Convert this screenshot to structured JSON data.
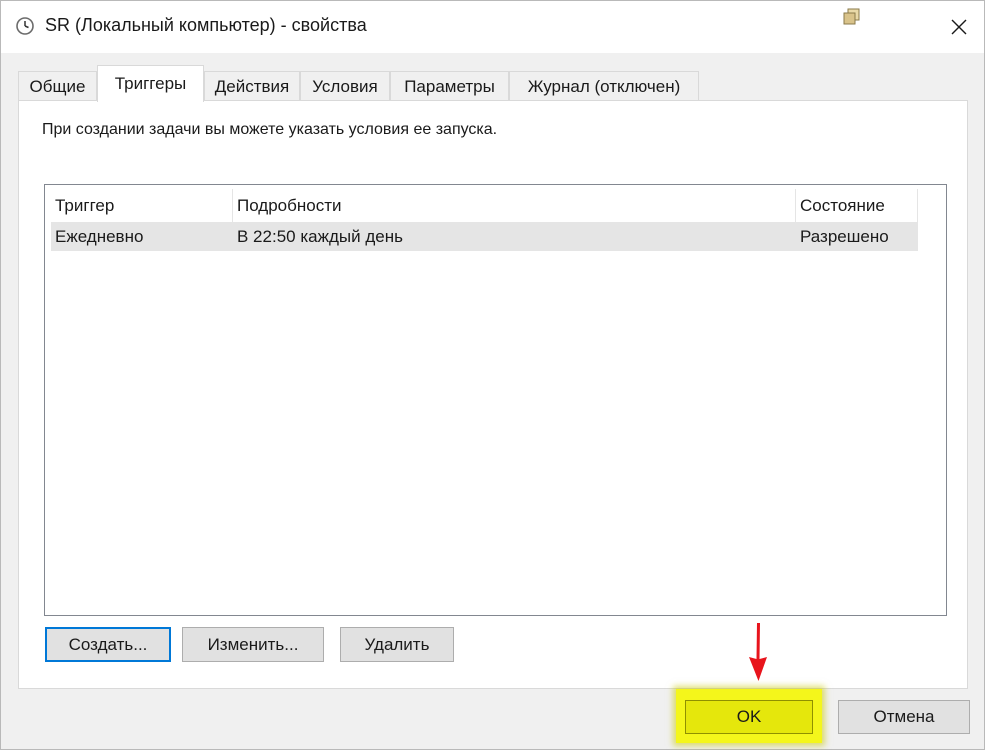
{
  "window": {
    "title": "SR (Локальный компьютер) - свойства",
    "title_icon": "clock-icon",
    "restore_icon": "restore-window-icon",
    "close_icon": "close-icon"
  },
  "tabs": [
    {
      "label": "Общие",
      "active": false
    },
    {
      "label": "Триггеры",
      "active": true
    },
    {
      "label": "Действия",
      "active": false
    },
    {
      "label": "Условия",
      "active": false
    },
    {
      "label": "Параметры",
      "active": false
    },
    {
      "label": "Журнал (отключен)",
      "active": false
    }
  ],
  "triggers_panel": {
    "description": "При создании задачи вы можете указать условия ее запуска.",
    "columns": [
      "Триггер",
      "Подробности",
      "Состояние"
    ],
    "rows": [
      {
        "trigger": "Ежедневно",
        "details": "В 22:50 каждый день",
        "status": "Разрешено"
      }
    ],
    "buttons": {
      "create": "Создать...",
      "edit": "Изменить...",
      "delete": "Удалить"
    }
  },
  "footer": {
    "ok": "OK",
    "cancel": "Отмена"
  },
  "colors": {
    "highlight": "#f4f61b",
    "arrow": "#e8141c",
    "accent": "#0078d7"
  }
}
